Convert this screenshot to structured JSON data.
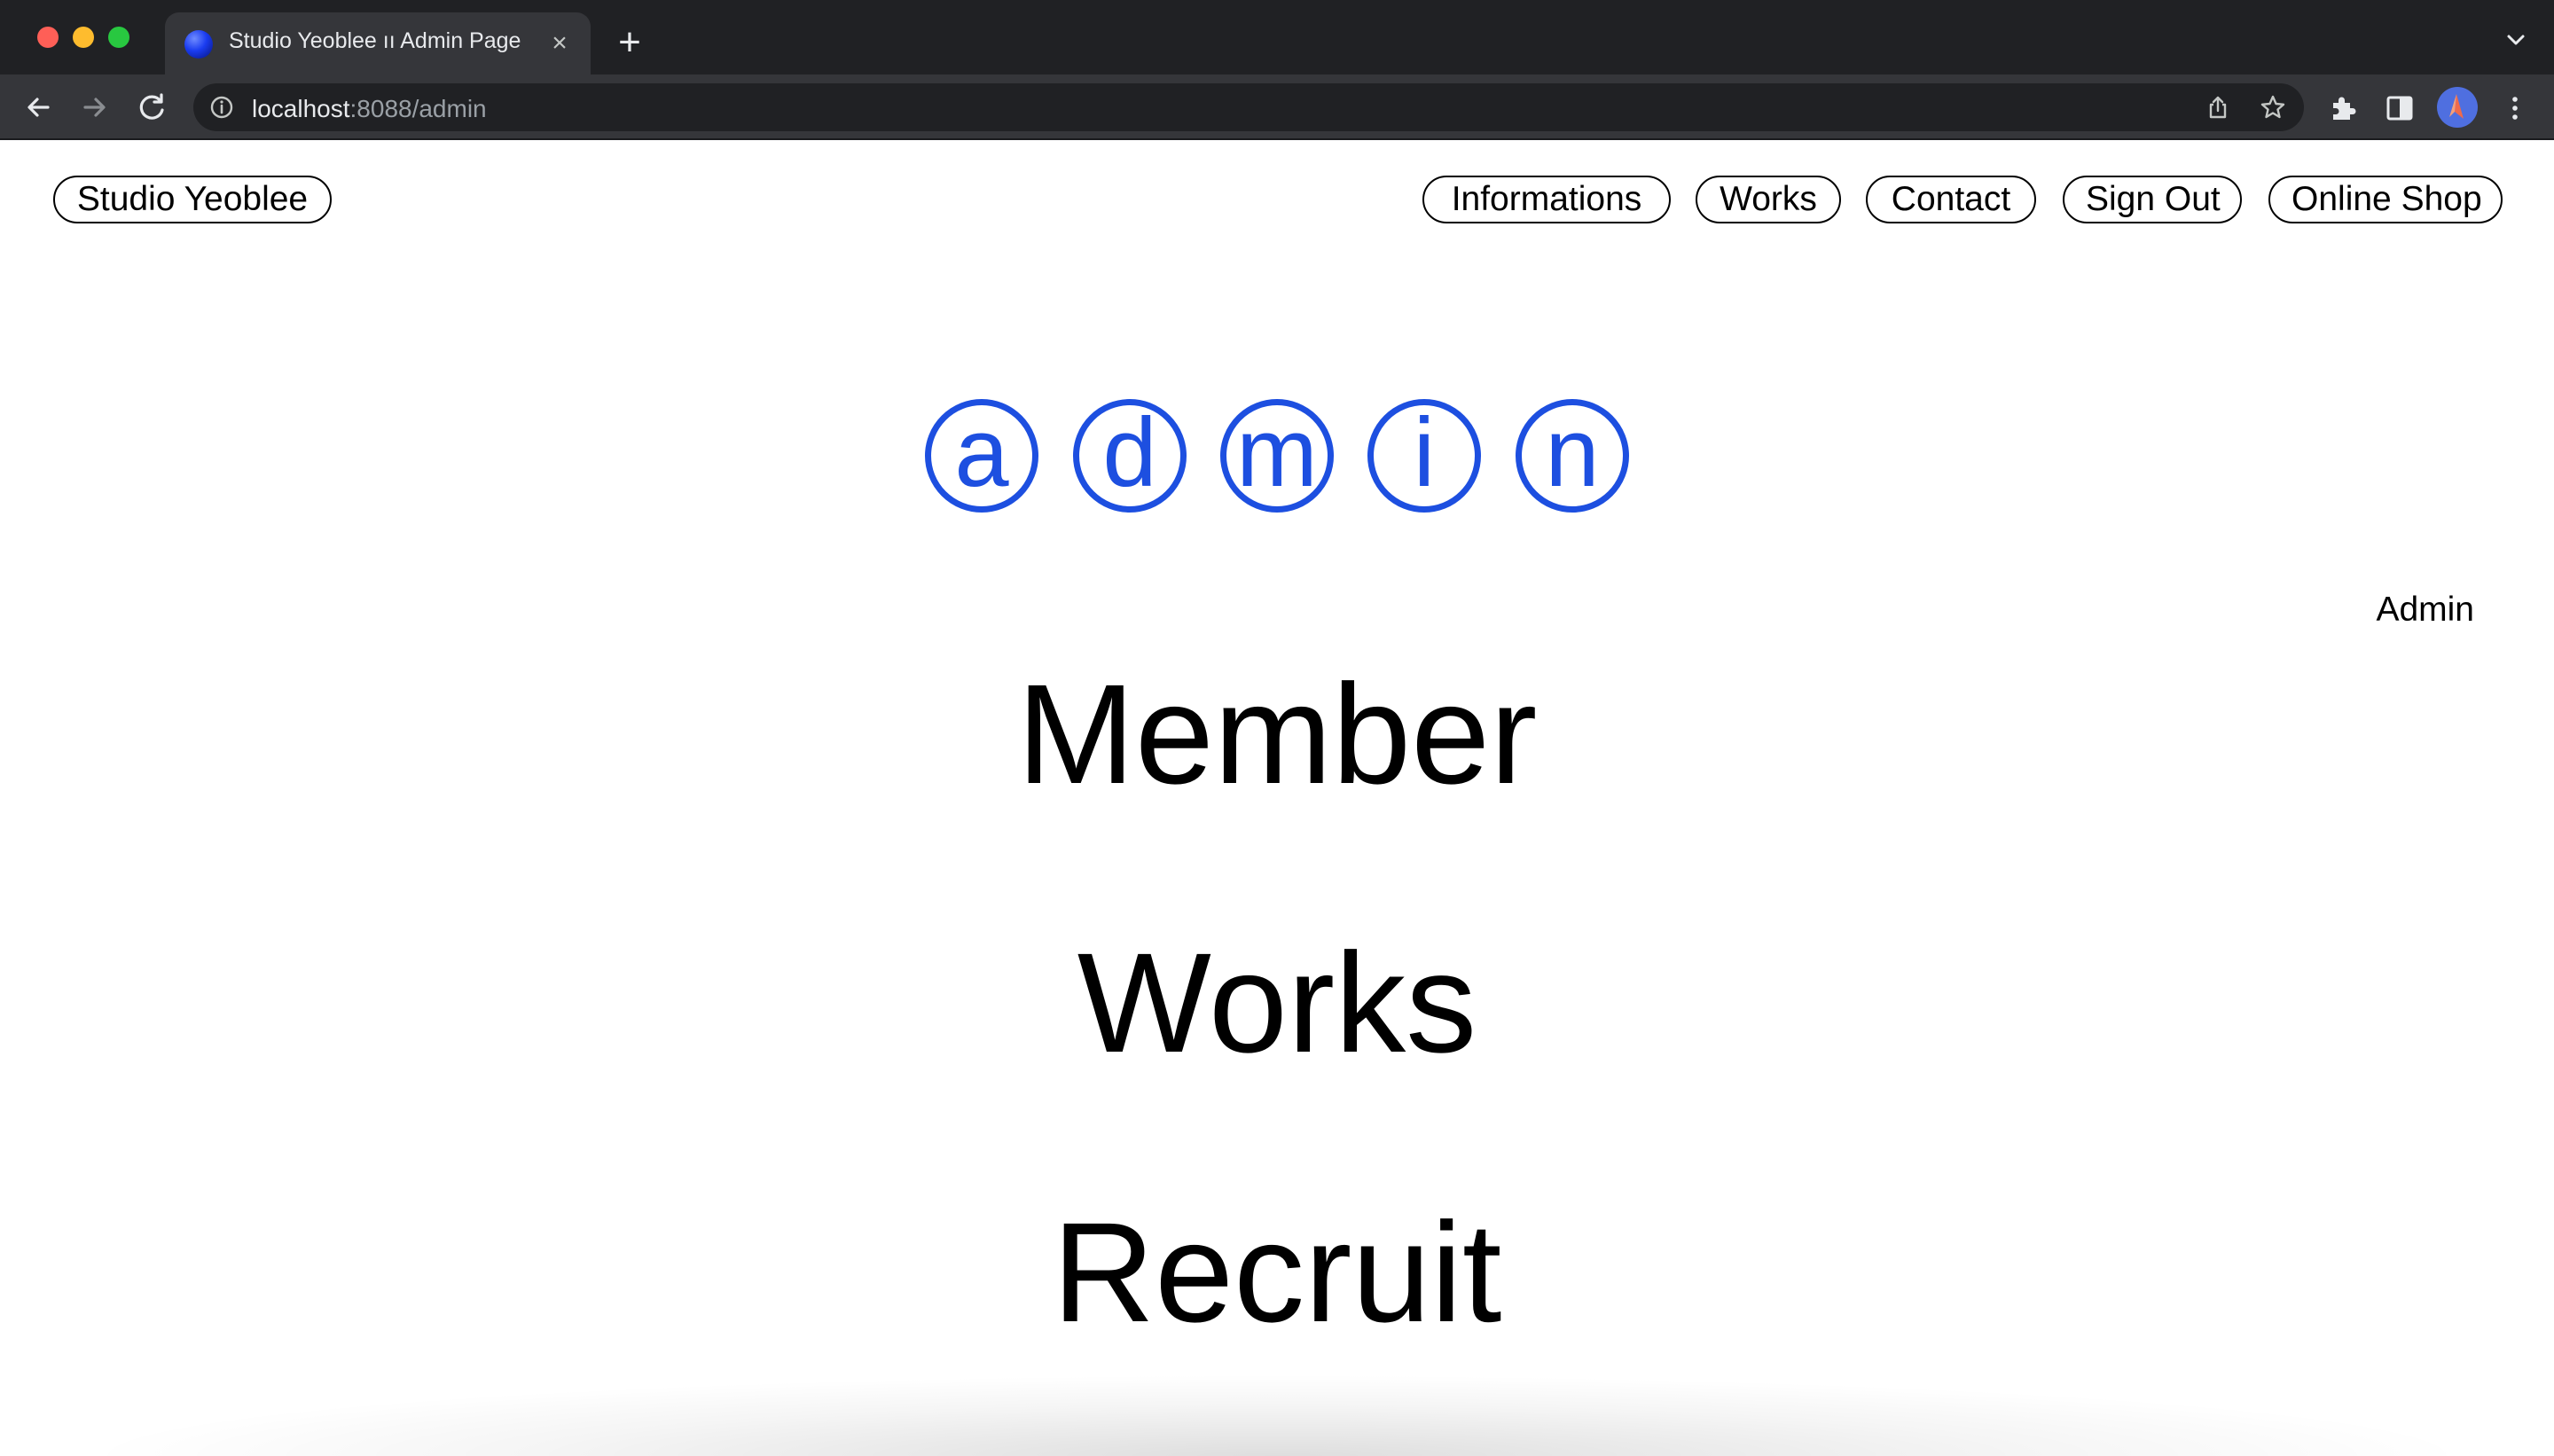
{
  "browser": {
    "tab_title": "Studio Yeoblee ıı Admin Page",
    "url_host": "localhost",
    "url_rest": ":8088/admin"
  },
  "header": {
    "logo": "Studio Yeoblee",
    "nav": {
      "informations": "Informations",
      "works": "Works",
      "contact": "Contact",
      "sign_out": "Sign Out",
      "online_shop": "Online Shop"
    }
  },
  "hero": {
    "letters": [
      "a",
      "d",
      "m",
      "i",
      "n"
    ],
    "accent_color": "#1d4fe0"
  },
  "side_label": "Admin",
  "menu": {
    "member": "Member",
    "works": "Works",
    "recruit": "Recruit"
  }
}
